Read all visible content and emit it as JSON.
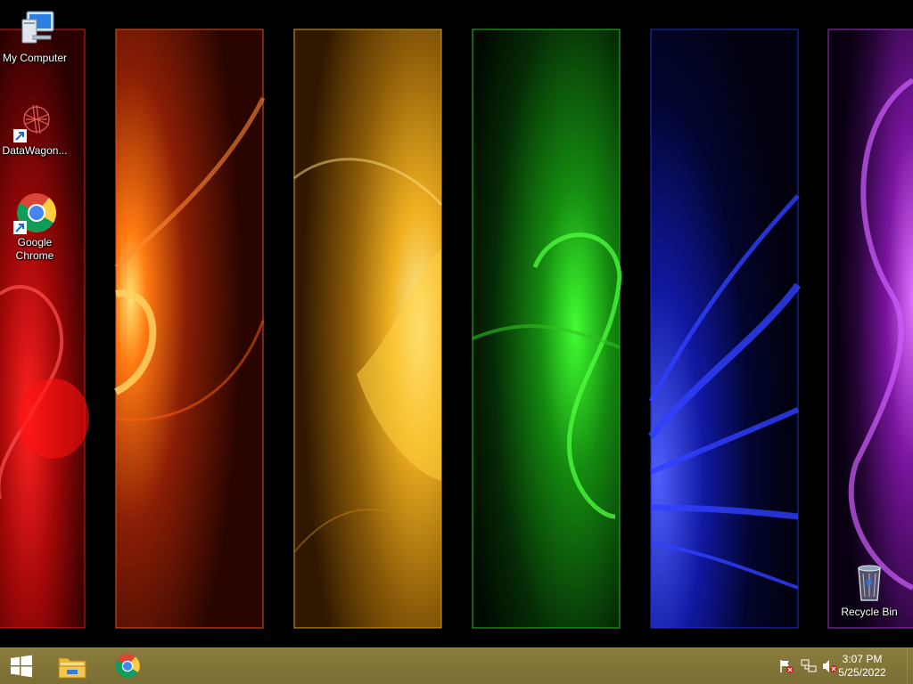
{
  "desktop": {
    "icons": [
      {
        "label": "My Computer",
        "icon": "my-computer-icon"
      },
      {
        "label": "DataWagon...",
        "icon": "datawagon-icon"
      },
      {
        "label": "Google Chrome",
        "icon": "chrome-icon"
      },
      {
        "label": "Recycle Bin",
        "icon": "recycle-bin-icon"
      }
    ],
    "wallpaper_colors": [
      "#e01010",
      "#ff5a0a",
      "#f0b010",
      "#20c010",
      "#2030ff",
      "#a020d0"
    ]
  },
  "taskbar": {
    "color": "#7f7237",
    "start_icon": "windows-logo-icon",
    "pinned": [
      {
        "name": "File Explorer",
        "icon": "folder-icon"
      },
      {
        "name": "Google Chrome",
        "icon": "chrome-icon"
      }
    ],
    "tray": [
      {
        "icon": "action-center-flag-icon"
      },
      {
        "icon": "network-icon"
      },
      {
        "icon": "volume-muted-icon"
      }
    ],
    "clock": {
      "time": "3:07 PM",
      "date": "5/25/2022"
    }
  }
}
